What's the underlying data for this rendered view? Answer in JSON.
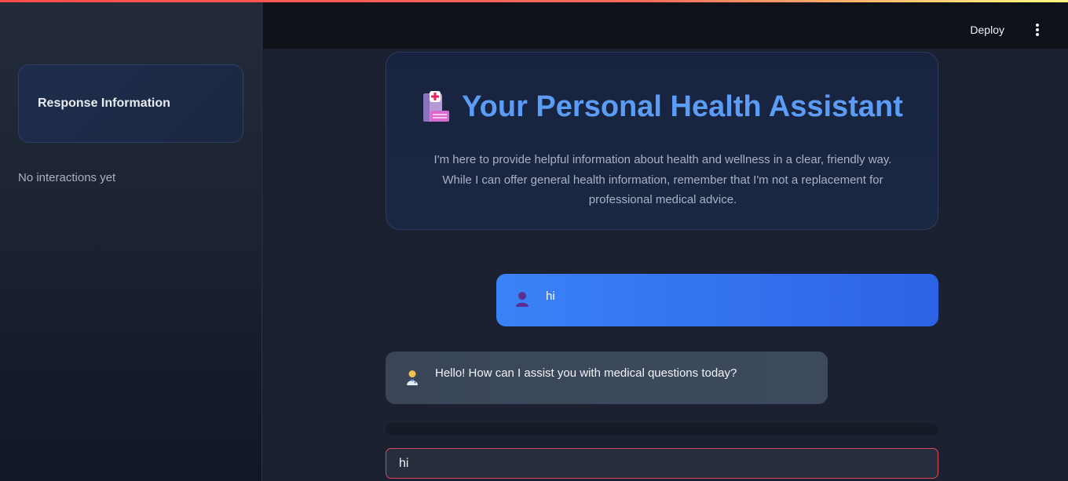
{
  "sidebar": {
    "card_title": "Response Information",
    "status_text": "No interactions yet"
  },
  "header": {
    "deploy_label": "Deploy",
    "menu_icon": "vertical-ellipsis-icon"
  },
  "hero": {
    "icon": "hospital-icon",
    "title": "Your Personal Health Assistant",
    "description": "I'm here to provide helpful information about health and wellness in a clear, friendly way. While I can offer general health information, remember that I'm not a replacement for professional medical advice."
  },
  "messages": [
    {
      "role": "user",
      "avatar": "user-avatar-icon",
      "text": "hi"
    },
    {
      "role": "assistant",
      "avatar": "doctor-avatar-icon",
      "text": "Hello! How can I assist you with medical questions today?"
    }
  ],
  "chat_input": {
    "value": "hi",
    "placeholder": ""
  },
  "colors": {
    "accent_blue": "#5b9cf7",
    "user_bubble": "#3b82f6",
    "input_border": "#e0485a"
  }
}
